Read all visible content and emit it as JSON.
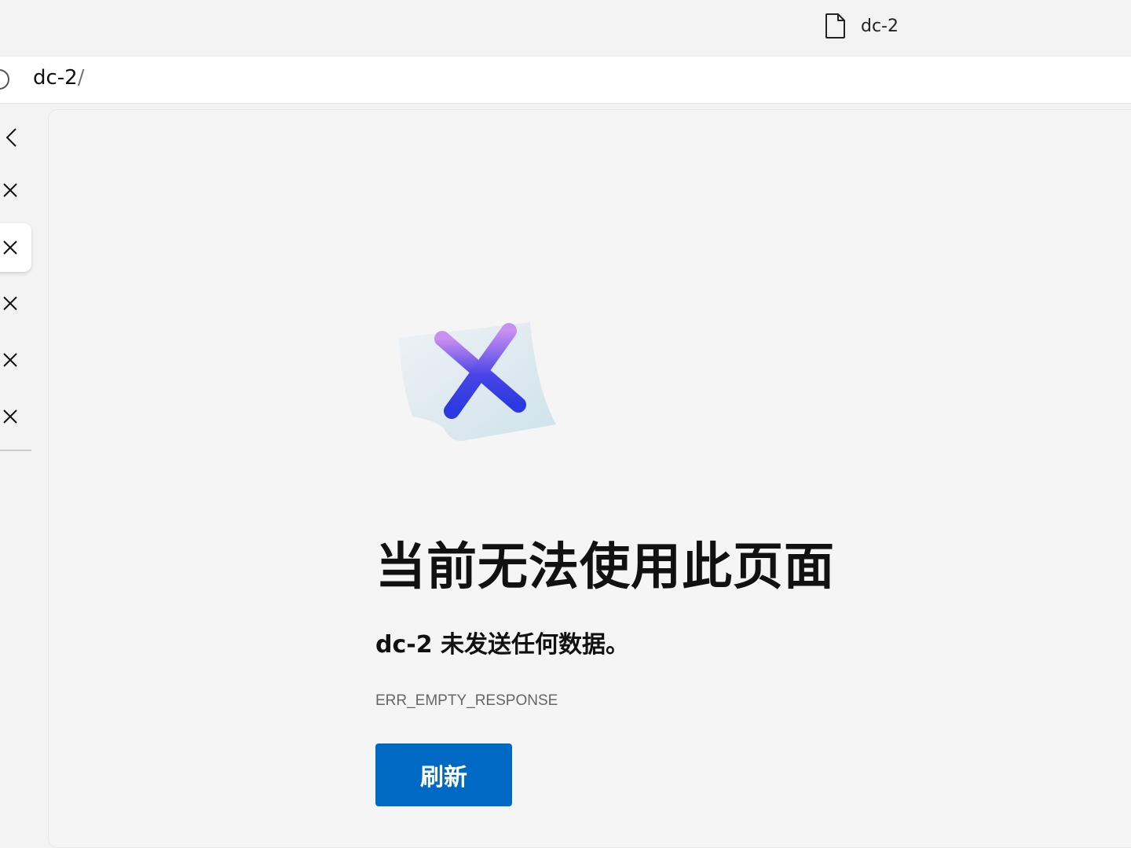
{
  "tab": {
    "title": "dc-2",
    "icon": "document-icon"
  },
  "address_bar": {
    "host": "dc-2",
    "path": "/"
  },
  "sidebar": {
    "items": [
      {
        "icon": "back-icon"
      },
      {
        "icon": "close-icon"
      },
      {
        "icon": "close-icon",
        "active": true
      },
      {
        "icon": "close-icon"
      },
      {
        "icon": "close-icon"
      },
      {
        "icon": "close-icon"
      }
    ]
  },
  "error": {
    "title": "当前无法使用此页面",
    "message": "dc-2 未发送任何数据。",
    "code": "ERR_EMPTY_RESPONSE",
    "refresh_label": "刷新"
  },
  "colors": {
    "accent": "#0069c4"
  }
}
